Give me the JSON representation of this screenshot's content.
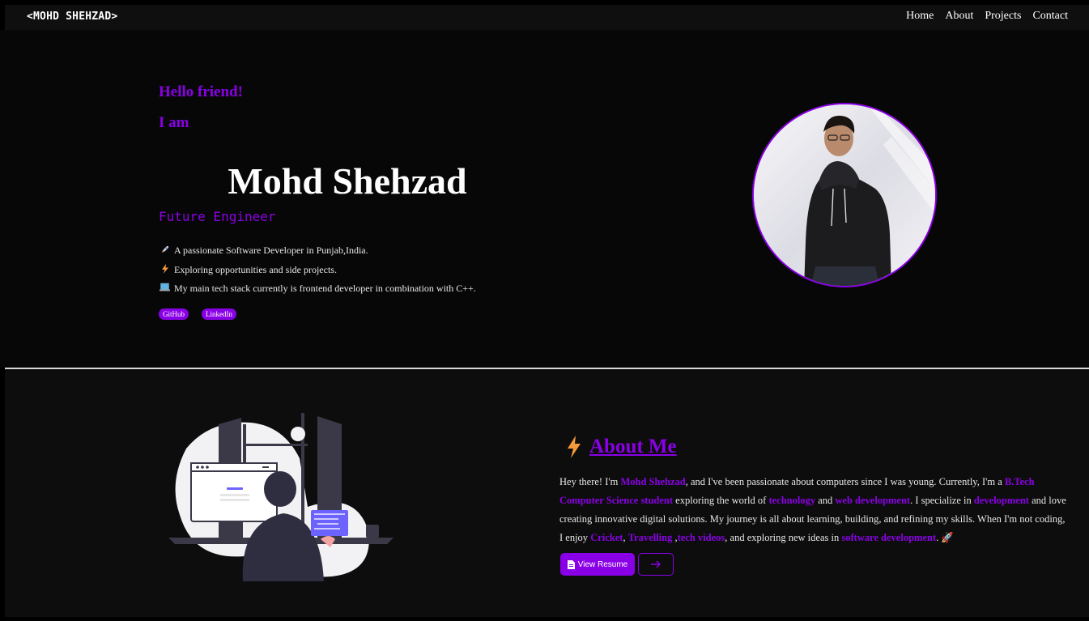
{
  "nav": {
    "logo": "<MOHD SHEHZAD>",
    "links": [
      "Home",
      "About",
      "Projects",
      "Contact"
    ]
  },
  "hero": {
    "greeting": "Hello friend!",
    "intro": "I am",
    "name": "Mohd Shehzad",
    "role": "Future Engineer",
    "bullets": [
      {
        "icon": "rocket-icon",
        "text": "A passionate Software Developer in Punjab,India."
      },
      {
        "icon": "lightning-icon",
        "text": "Exploring opportunities and side projects."
      },
      {
        "icon": "laptop-icon",
        "text": "My main tech stack currently is frontend developer in combination with C++."
      }
    ],
    "links": [
      "GitHub",
      "LinkedIn"
    ]
  },
  "about": {
    "title": "About Me",
    "paragraph": {
      "p1": "Hey there! I'm ",
      "h1": "Mohd Shehzad",
      "p2": ", and I've been passionate about computers since I was young. Currently, I'm a ",
      "h2": "B.Tech Computer Science student",
      "p3": " exploring the world of ",
      "h3": "technology",
      "p4": " and ",
      "h4": "web development",
      "p5": ". I specialize in ",
      "h5": "development",
      "p6": " and love creating innovative digital solutions. My journey is all about learning, building, and refining my skills. When I'm not coding, I enjoy ",
      "h6": "Cricket",
      "p7": ", ",
      "h7": "Travelling",
      "p8": " ,",
      "h8": "tech videos",
      "p9": ", and exploring new ideas in ",
      "h9": "software development",
      "p10": ". 🚀"
    },
    "resume_button": "View Resume"
  },
  "colors": {
    "accent": "#8a00e6",
    "background": "#070707",
    "navbar": "#0f0f0f",
    "section": "#0d0d0d"
  }
}
